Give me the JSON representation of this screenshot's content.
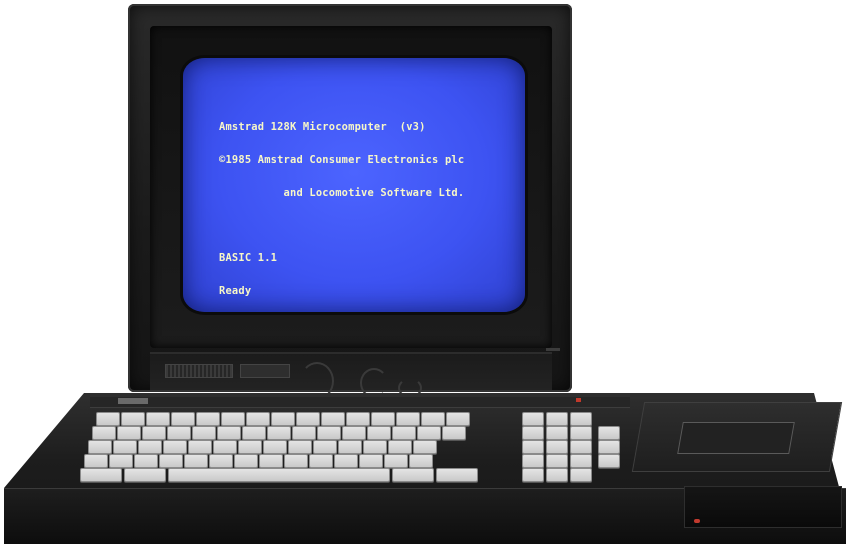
{
  "screen": {
    "lines": [
      "Amstrad 128K Microcomputer  (v3)",
      "©1985 Amstrad Consumer Electronics plc",
      "          and Locomotive Software Ltd.",
      "BASIC 1.1",
      "Ready"
    ],
    "text_color": "#f7f7c8",
    "background_color": "#3d53f2"
  },
  "computer": {
    "body_color": "#1d1d1d",
    "key_color": "#d9d9d9",
    "led_color": "#c23a2e"
  }
}
